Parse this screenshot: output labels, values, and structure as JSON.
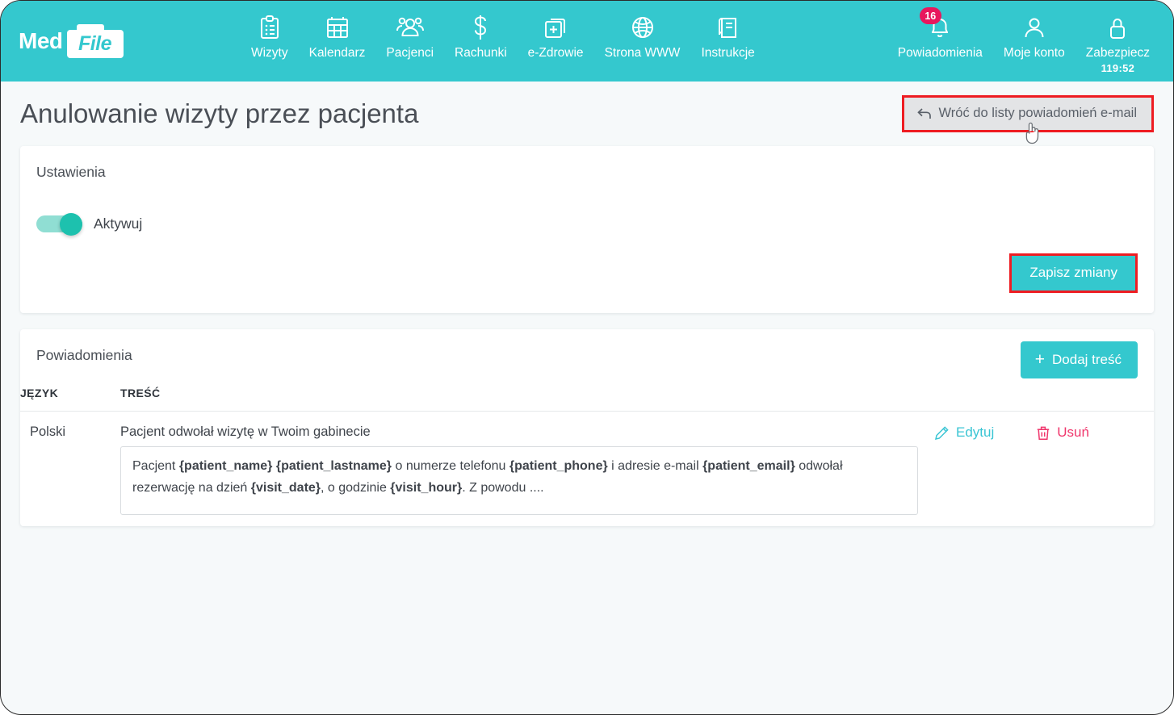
{
  "brand": {
    "logo_primary": "Med",
    "logo_secondary": "File"
  },
  "colors": {
    "header_teal": "#34c8ce",
    "accent_teal": "#34c8ce",
    "toggle_knob": "#1dc1ae",
    "toggle_track": "#90ded3",
    "badge_pink": "#e8175d",
    "delete_pink": "#f0366c",
    "edit_teal": "#3ac5d4",
    "highlight_red": "#ee1c22",
    "page_bg": "#f6f9fa",
    "back_btn_bg": "#e3e4e6"
  },
  "topnav": {
    "items": [
      {
        "label": "Wizyty",
        "icon": "clipboard-icon"
      },
      {
        "label": "Kalendarz",
        "icon": "calendar-icon"
      },
      {
        "label": "Pacjenci",
        "icon": "people-icon"
      },
      {
        "label": "Rachunki",
        "icon": "dollar-icon"
      },
      {
        "label": "e-Zdrowie",
        "icon": "document-plus-icon"
      },
      {
        "label": "Strona WWW",
        "icon": "globe-icon"
      },
      {
        "label": "Instrukcje",
        "icon": "book-icon"
      }
    ],
    "right_items": [
      {
        "label": "Powiadomienia",
        "icon": "bell-icon",
        "badge": "16",
        "sub": ""
      },
      {
        "label": "Moje konto",
        "icon": "person-icon",
        "badge": "",
        "sub": ""
      },
      {
        "label": "Zabezpiecz",
        "icon": "lock-icon",
        "badge": "",
        "sub": "119:52"
      }
    ]
  },
  "page": {
    "title": "Anulowanie wizyty przez pacjenta",
    "back_button": "Wróć do listy powiadomień e-mail",
    "back_icon": "back-arrow-icon",
    "cursor": "pointing-hand-cursor"
  },
  "settings": {
    "title": "Ustawienia",
    "toggle_label": "Aktywuj",
    "toggle_state": "on",
    "save_button": "Zapisz zmiany"
  },
  "notifications": {
    "title": "Powiadomienia",
    "add_button": "Dodaj treść",
    "add_icon": "plus-icon",
    "columns": [
      "JĘZYK",
      "TREŚĆ"
    ],
    "rows": [
      {
        "language": "Polski",
        "subject": "Pacjent odwołał wizytę w Twoim gabinecie",
        "body_parts": [
          {
            "t": "Pacjent ",
            "b": false
          },
          {
            "t": "{patient_name}",
            "b": true
          },
          {
            "t": " ",
            "b": false
          },
          {
            "t": "{patient_lastname}",
            "b": true
          },
          {
            "t": " o numerze telefonu ",
            "b": false
          },
          {
            "t": "{patient_phone}",
            "b": true
          },
          {
            "t": " i adresie e-mail ",
            "b": false
          },
          {
            "t": "{patient_email}",
            "b": true
          },
          {
            "t": " odwołał rezerwację na dzień ",
            "b": false
          },
          {
            "t": "{visit_date}",
            "b": true
          },
          {
            "t": ", o godzinie ",
            "b": false
          },
          {
            "t": "{visit_hour}",
            "b": true
          },
          {
            "t": ". Z powodu ....",
            "b": false
          }
        ],
        "edit_label": "Edytuj",
        "edit_icon": "pencil-icon",
        "delete_label": "Usuń",
        "delete_icon": "trash-icon"
      }
    ]
  }
}
